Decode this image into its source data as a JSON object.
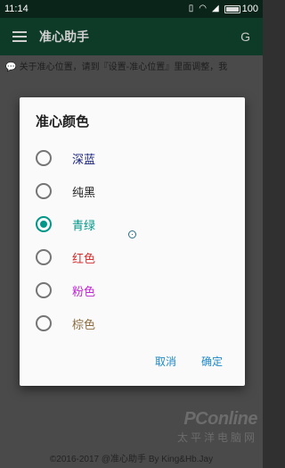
{
  "status_bar": {
    "time": "11:14",
    "icons": [
      "vibrate-icon",
      "wifi-icon",
      "signal-icon",
      "battery-icon"
    ],
    "battery_level": "100"
  },
  "app_bar": {
    "title": "准心助手",
    "action_label": "G"
  },
  "notice": {
    "text": "💬 关于准心位置，请到『设置-准心位置』里面调整，我"
  },
  "footer": {
    "text": "©2016-2017 @准心助手 By King&Hb.Jay"
  },
  "watermark": {
    "logo": "PConline",
    "sub": "太平洋电脑网"
  },
  "dialog": {
    "title": "准心颜色",
    "options": [
      {
        "label": "深蓝",
        "color": "#1a237e",
        "checked": false
      },
      {
        "label": "纯黑",
        "color": "#212121",
        "checked": false
      },
      {
        "label": "青绿",
        "color": "#009688",
        "checked": true
      },
      {
        "label": "红色",
        "color": "#d32f2f",
        "checked": false
      },
      {
        "label": "粉色",
        "color": "#c026d3",
        "checked": false
      },
      {
        "label": "棕色",
        "color": "#8d6e43",
        "checked": false
      }
    ],
    "cancel_label": "取消",
    "ok_label": "确定"
  },
  "colors": {
    "accent": "#009688",
    "app_bar": "#0e3a28",
    "button_text": "#1e88c8"
  }
}
